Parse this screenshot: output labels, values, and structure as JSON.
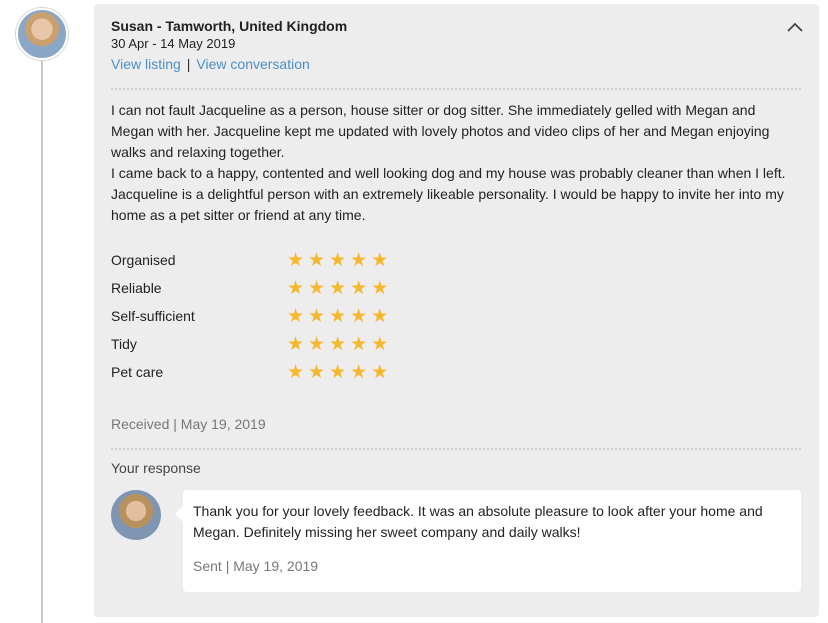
{
  "review": {
    "reviewer": "Susan - Tamworth, United Kingdom",
    "dates": "30 Apr - 14 May 2019",
    "links": {
      "view_listing": "View listing",
      "separator": "|",
      "view_conversation": "View conversation"
    },
    "paragraphs": [
      "I can not fault Jacqueline as a person, house sitter or dog sitter. She immediately gelled with Megan and Megan with her. Jacqueline kept me updated with lovely photos and video clips of her and Megan enjoying walks and relaxing together.",
      "I came back to a happy, contented and well looking dog and my house was probably cleaner than when I left. Jacqueline is a delightful person with an extremely likeable personality. I would be happy to invite her into my home as a pet sitter or friend at any time."
    ],
    "ratings": [
      {
        "label": "Organised",
        "stars": 5
      },
      {
        "label": "Reliable",
        "stars": 5
      },
      {
        "label": "Self-sufficient",
        "stars": 5
      },
      {
        "label": "Tidy",
        "stars": 5
      },
      {
        "label": "Pet care",
        "stars": 5
      }
    ],
    "received": "Received | May 19, 2019",
    "your_response_label": "Your response",
    "response": {
      "text": "Thank you for your lovely feedback. It was an absolute pleasure to look after your home and Megan. Definitely missing her sweet company and daily walks!",
      "sent": "Sent | May 19, 2019"
    }
  },
  "colors": {
    "star": "#f5b82e",
    "link": "#4a90c8",
    "card_background": "#ededed"
  },
  "icons": {
    "collapse": "chevron-up-icon",
    "star": "star-icon"
  }
}
